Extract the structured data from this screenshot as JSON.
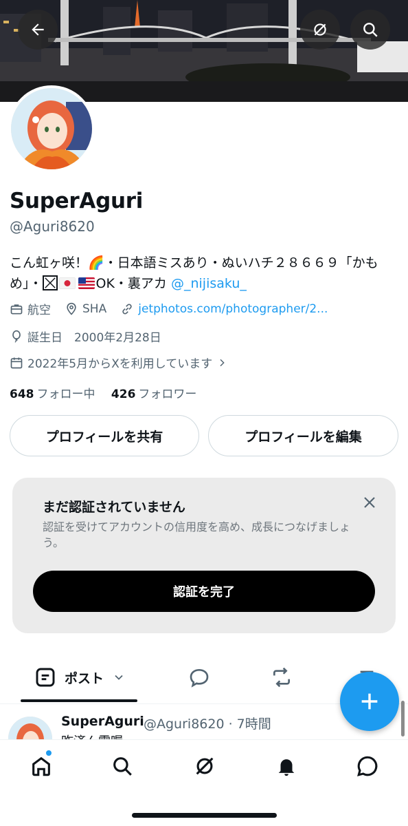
{
  "profile": {
    "name": "SuperAguri",
    "handle": "@Aguri8620",
    "bio_text_1": "こん虹ヶ咲！🌈・日本語ミスあり・ぬいハチ２８６６９「かもめ」・",
    "bio_text_2": "OK・裏アカ ",
    "bio_link": "@_nijisaku_",
    "category": "航空",
    "location": "SHA",
    "website": "jetphotos.com/photographer/2...",
    "birthday": "誕生日　2000年2月28日",
    "joined": "2022年5月からXを利用しています",
    "following_count": "648",
    "following_label": "フォロー中",
    "followers_count": "426",
    "followers_label": "フォロワー"
  },
  "buttons": {
    "share": "プロフィールを共有",
    "edit": "プロフィールを編集"
  },
  "verification": {
    "title": "まだ認証されていません",
    "description": "認証を受けてアカウントの信用度を高め、成長につなげましょう。",
    "cta": "認証を完了"
  },
  "tabs": {
    "posts_label": "ポスト"
  },
  "tweet": {
    "name": "SuperAguri",
    "meta": "@Aguri8620 · 7時間",
    "text": "昨済ん需喔"
  },
  "colors": {
    "accent": "#1d9bf0",
    "text": "#0f1419",
    "muted": "#536471",
    "card_bg": "#ebebeb"
  },
  "icons": {
    "back": "arrow-left-icon",
    "grok": "grok-icon",
    "search": "search-icon",
    "category": "briefcase-icon",
    "location": "location-pin-icon",
    "website": "link-icon",
    "birthday": "balloon-icon",
    "joined": "calendar-icon",
    "close": "close-icon",
    "posts_tab": "posts-tab-icon",
    "replies_tab": "reply-bubble-icon",
    "reposts_tab": "repost-icon",
    "compose": "plus-icon",
    "nav_home": "home-icon",
    "nav_search": "search-icon",
    "nav_grok": "grok-icon",
    "nav_notifications": "bell-icon",
    "nav_messages": "message-icon"
  }
}
